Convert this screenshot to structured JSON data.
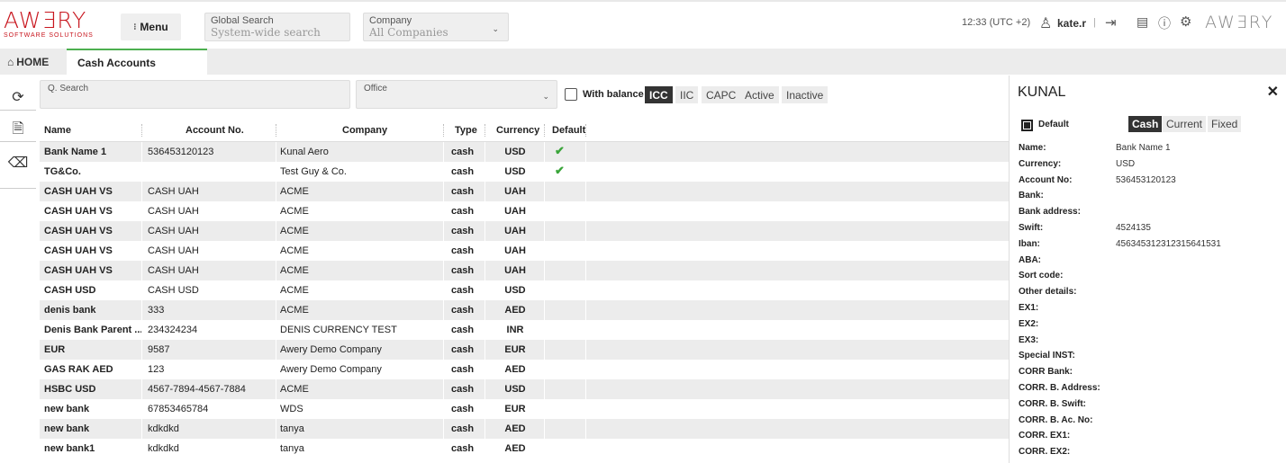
{
  "header": {
    "logo_word": "AWƎRY",
    "logo_sub": "SOFTWARE SOLUTIONS",
    "menu_label": "Menu",
    "global_search_label": "Global Search",
    "global_search_placeholder": "System-wide search",
    "company_label": "Company",
    "company_value": "All Companies",
    "time": "12:33 (UTC +2)",
    "user": "kate.r",
    "brand_right": "AWƎRY"
  },
  "tabs": {
    "home": "HOME",
    "active": "Cash Accounts"
  },
  "filters": {
    "search_label": "Q. Search",
    "office_label": "Office",
    "with_balance": "With balance",
    "tags": [
      {
        "label": "ICC",
        "active": true
      },
      {
        "label": "IIC",
        "active": false
      },
      {
        "label": "CAPC",
        "active": false
      },
      {
        "label": "Active",
        "active": false
      },
      {
        "label": "Inactive",
        "active": false
      }
    ]
  },
  "table": {
    "columns": {
      "name": "Name",
      "account": "Account No.",
      "company": "Company",
      "type": "Type",
      "currency": "Currency",
      "default": "Default"
    },
    "rows": [
      {
        "name": "Bank Name 1",
        "account": "536453120123",
        "company": "Kunal Aero",
        "type": "cash",
        "currency": "USD",
        "default": "✔"
      },
      {
        "name": "TG&Co.",
        "account": "",
        "company": "Test Guy & Co.",
        "type": "cash",
        "currency": "USD",
        "default": "✔"
      },
      {
        "name": "CASH UAH VS",
        "account": "CASH UAH",
        "company": "ACME",
        "type": "cash",
        "currency": "UAH",
        "default": ""
      },
      {
        "name": "CASH UAH VS",
        "account": "CASH UAH",
        "company": "ACME",
        "type": "cash",
        "currency": "UAH",
        "default": ""
      },
      {
        "name": "CASH UAH VS",
        "account": "CASH UAH",
        "company": "ACME",
        "type": "cash",
        "currency": "UAH",
        "default": ""
      },
      {
        "name": "CASH UAH VS",
        "account": "CASH UAH",
        "company": "ACME",
        "type": "cash",
        "currency": "UAH",
        "default": ""
      },
      {
        "name": "CASH UAH VS",
        "account": "CASH UAH",
        "company": "ACME",
        "type": "cash",
        "currency": "UAH",
        "default": ""
      },
      {
        "name": "CASH USD",
        "account": "CASH USD",
        "company": "ACME",
        "type": "cash",
        "currency": "USD",
        "default": ""
      },
      {
        "name": "denis bank",
        "account": "333",
        "company": "ACME",
        "type": "cash",
        "currency": "AED",
        "default": ""
      },
      {
        "name": "Denis Bank Parent ...",
        "account": "234324234",
        "company": "DENIS CURRENCY TEST",
        "type": "cash",
        "currency": "INR",
        "default": ""
      },
      {
        "name": "EUR",
        "account": "9587",
        "company": "Awery Demo Company",
        "type": "cash",
        "currency": "EUR",
        "default": ""
      },
      {
        "name": "GAS RAK AED",
        "account": "123",
        "company": "Awery Demo Company",
        "type": "cash",
        "currency": "AED",
        "default": ""
      },
      {
        "name": "HSBC USD",
        "account": "4567-7894-4567-7884",
        "company": "ACME",
        "type": "cash",
        "currency": "USD",
        "default": ""
      },
      {
        "name": "new bank",
        "account": "67853465784",
        "company": "WDS",
        "type": "cash",
        "currency": "EUR",
        "default": ""
      },
      {
        "name": "new bank",
        "account": "kdkdkd",
        "company": "tanya",
        "type": "cash",
        "currency": "AED",
        "default": ""
      },
      {
        "name": "new bank1",
        "account": "kdkdkd",
        "company": "tanya",
        "type": "cash",
        "currency": "AED",
        "default": ""
      }
    ]
  },
  "panel": {
    "title": "KUNAL",
    "default_label": "Default",
    "segments": [
      {
        "label": "Cash",
        "active": true
      },
      {
        "label": "Current",
        "active": false
      },
      {
        "label": "Fixed",
        "active": false
      }
    ],
    "fields": [
      {
        "label": "Name:",
        "value": "Bank Name 1"
      },
      {
        "label": "Currency:",
        "value": "USD"
      },
      {
        "label": "Account No:",
        "value": "536453120123"
      },
      {
        "label": "Bank:",
        "value": ""
      },
      {
        "label": "Bank address:",
        "value": ""
      },
      {
        "label": "Swift:",
        "value": "4524135"
      },
      {
        "label": "Iban:",
        "value": "456345312312315641531"
      },
      {
        "label": "ABA:",
        "value": ""
      },
      {
        "label": "Sort code:",
        "value": ""
      },
      {
        "label": "Other details:",
        "value": ""
      },
      {
        "label": "EX1:",
        "value": ""
      },
      {
        "label": "EX2:",
        "value": ""
      },
      {
        "label": "EX3:",
        "value": ""
      },
      {
        "label": "Special INST:",
        "value": ""
      },
      {
        "label": "CORR Bank:",
        "value": ""
      },
      {
        "label": "CORR. B. Address:",
        "value": ""
      },
      {
        "label": "CORR. B. Swift:",
        "value": ""
      },
      {
        "label": "CORR. B. Ac. No:",
        "value": ""
      },
      {
        "label": "CORR. EX1:",
        "value": ""
      },
      {
        "label": "CORR. EX2:",
        "value": ""
      }
    ]
  },
  "colors": {
    "brand_red": "#c8161e",
    "accent_green": "#4caf50",
    "check_green": "#3aa53a",
    "active_dark": "#333333"
  },
  "icons": {
    "refresh": "refresh-icon",
    "document": "document-icon",
    "eraser": "eraser-icon",
    "home": "home-icon",
    "user": "user-icon",
    "logout": "logout-icon",
    "chat": "chat-icon",
    "info": "info-icon",
    "gear": "gear-icon",
    "close": "close-icon"
  }
}
